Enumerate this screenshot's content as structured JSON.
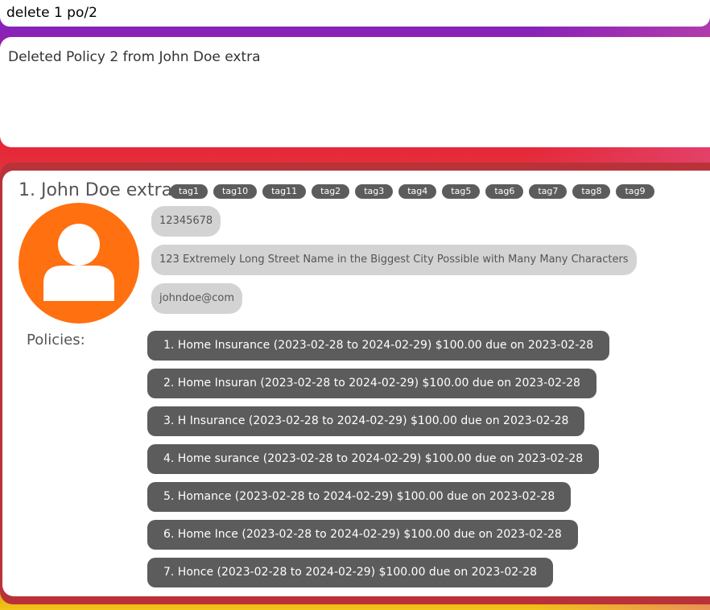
{
  "command": {
    "value": "delete 1 po/2",
    "placeholder": ""
  },
  "result": {
    "text": "Deleted Policy 2 from John Doe extra"
  },
  "person": {
    "name": "1. John Doe extra",
    "tags": [
      "tag1",
      "tag10",
      "tag11",
      "tag2",
      "tag3",
      "tag4",
      "tag5",
      "tag6",
      "tag7",
      "tag8",
      "tag9"
    ],
    "phone": "12345678",
    "address": "123 Extremely Long Street Name in the Biggest City Possible with Many Many Characters",
    "email": "johndoe@com",
    "policies_label": "Policies:",
    "policies": [
      "1. Home Insurance (2023-02-28 to 2024-02-29) $100.00 due on 2023-02-28",
      "2. Home Insuran (2023-02-28 to 2024-02-29) $100.00 due on 2023-02-28",
      "3. H Insurance (2023-02-28 to 2024-02-29) $100.00 due on 2023-02-28",
      "4. Home surance (2023-02-28 to 2024-02-29) $100.00 due on 2023-02-28",
      "5. Homance (2023-02-28 to 2024-02-29) $100.00 due on 2023-02-28",
      "6. Home Ince (2023-02-28 to 2024-02-29) $100.00 due on 2023-02-28",
      "7. Honce (2023-02-28 to 2024-02-29) $100.00 due on 2023-02-28"
    ],
    "avatar_icon": "user-avatar-icon"
  },
  "colors": {
    "avatar": "#ff7010",
    "tag_bg": "#5c5c5c",
    "pill_bg": "#d3d3d3",
    "policy_bg": "#5c5c5c"
  }
}
